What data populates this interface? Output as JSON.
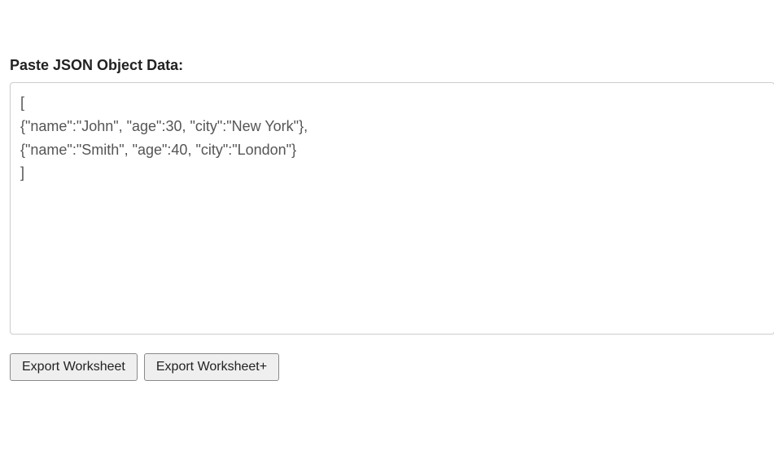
{
  "form": {
    "heading": "Paste JSON Object Data:",
    "textarea_value": "[\n{\"name\":\"John\", \"age\":30, \"city\":\"New York\"},\n{\"name\":\"Smith\", \"age\":40, \"city\":\"London\"}\n]"
  },
  "buttons": {
    "export_label": "Export Worksheet",
    "export_plus_label": "Export Worksheet+"
  }
}
